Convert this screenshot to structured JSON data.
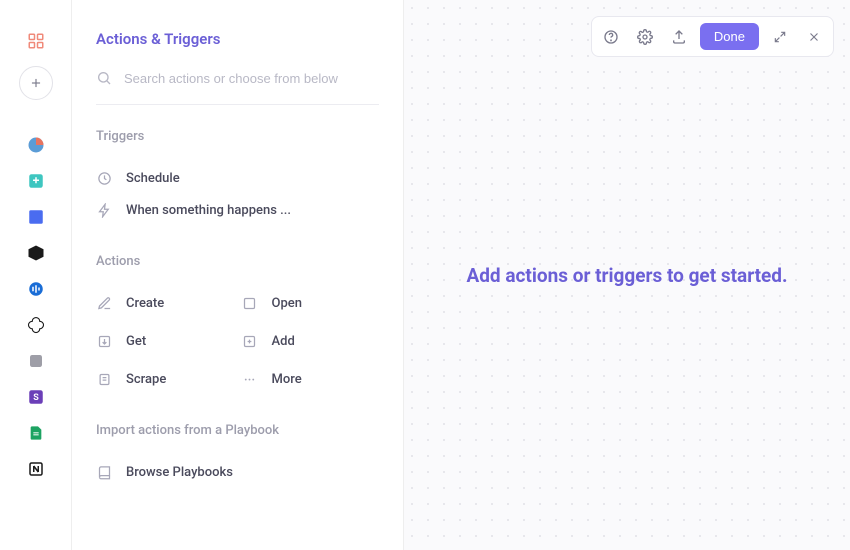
{
  "panel": {
    "title": "Actions & Triggers",
    "search_placeholder": "Search actions or choose from below"
  },
  "triggers": {
    "label": "Triggers",
    "items": [
      {
        "label": "Schedule"
      },
      {
        "label": "When something happens ..."
      }
    ]
  },
  "actions": {
    "label": "Actions",
    "items": [
      {
        "label": "Create"
      },
      {
        "label": "Open"
      },
      {
        "label": "Get"
      },
      {
        "label": "Add"
      },
      {
        "label": "Scrape"
      },
      {
        "label": "More"
      }
    ]
  },
  "import": {
    "label": "Import actions from a Playbook",
    "browse": "Browse Playbooks"
  },
  "canvas": {
    "message": "Add actions or triggers to get started."
  },
  "toolbar": {
    "done": "Done"
  }
}
